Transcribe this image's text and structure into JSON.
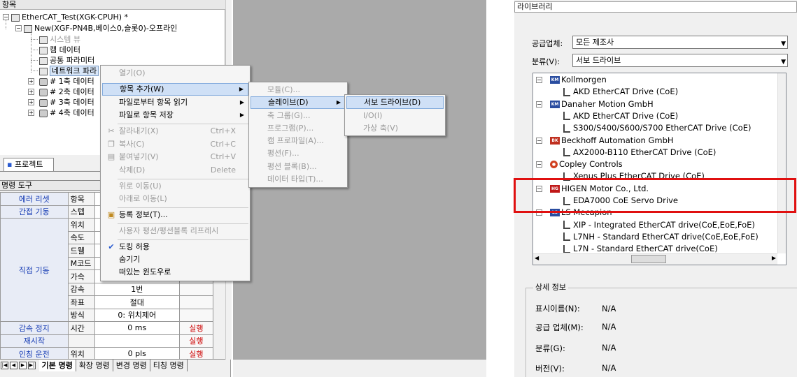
{
  "project_tree": {
    "header": "항목",
    "root": "EtherCAT_Test(XGK-CPUH) *",
    "module": "New(XGF-PN4B,베이스0,슬롯0)-오프라인",
    "items": [
      "시스템 뷰",
      "캠 데이터",
      "공통 파라미터",
      "네트워크 파라"
    ],
    "axes": [
      "# 1축 데이터",
      "# 2축 데이터",
      "# 3축 데이터",
      "# 4축 데이터"
    ],
    "project_tab": "프로젝트"
  },
  "command_tool": {
    "header": "명령 도구",
    "rows": [
      {
        "group": "에러 리셋",
        "label": "항목",
        "value": "",
        "run": ""
      },
      {
        "group": "간접 기동",
        "label": "스텝",
        "value": "",
        "run": ""
      },
      {
        "group": "",
        "label": "위치",
        "value": "",
        "run": ""
      },
      {
        "group": "",
        "label": "속도",
        "value": "",
        "run": ""
      },
      {
        "group": "",
        "label": "드웰",
        "value": "",
        "run": ""
      },
      {
        "group": "",
        "label": "M코드",
        "value": "",
        "run": ""
      },
      {
        "group": "직접 기동",
        "label": "가속",
        "value": "",
        "run": ""
      },
      {
        "group": "",
        "label": "감속",
        "value": "1번",
        "run": ""
      },
      {
        "group": "",
        "label": "좌표",
        "value": "절대",
        "run": ""
      },
      {
        "group": "",
        "label": "방식",
        "value": "0: 위치제어",
        "run": ""
      },
      {
        "group": "감속 정지",
        "label": "시간",
        "value": "0 ms",
        "run": "실행"
      },
      {
        "group": "재시작",
        "label": "",
        "value": "",
        "run": "실행"
      },
      {
        "group": "인칭 운전",
        "label": "위치",
        "value": "0 pls",
        "run": "실행"
      }
    ],
    "bottom_tabs": [
      "기본 명령",
      "확장 명령",
      "변경 명령",
      "티칭 명령"
    ]
  },
  "context_menu": {
    "items": [
      {
        "label": "열기(O)",
        "shortcut": "",
        "disabled": true
      },
      {
        "label": "항목 추가(W)",
        "shortcut": "",
        "disabled": false,
        "submenu": true
      },
      {
        "label": "파일로부터 항목 읽기",
        "shortcut": "",
        "disabled": false,
        "submenu": true
      },
      {
        "label": "파일로 항목 저장",
        "shortcut": "",
        "disabled": false,
        "submenu": true
      },
      {
        "label": "잘라내기(X)",
        "shortcut": "Ctrl+X",
        "disabled": true
      },
      {
        "label": "복사(C)",
        "shortcut": "Ctrl+C",
        "disabled": true
      },
      {
        "label": "붙여넣기(V)",
        "shortcut": "Ctrl+V",
        "disabled": true
      },
      {
        "label": "삭제(D)",
        "shortcut": "Delete",
        "disabled": true
      },
      {
        "label": "위로 이동(U)",
        "shortcut": "",
        "disabled": true
      },
      {
        "label": "아래로 이동(L)",
        "shortcut": "",
        "disabled": true
      },
      {
        "label": "등록 정보(T)...",
        "shortcut": "",
        "disabled": false
      },
      {
        "label": "사용자 평션/평션블록 리프레시",
        "shortcut": "",
        "disabled": true
      },
      {
        "label": "도킹 허용",
        "shortcut": "",
        "disabled": false
      },
      {
        "label": "숨기기",
        "shortcut": "",
        "disabled": false
      },
      {
        "label": "떠있는 윈도우로",
        "shortcut": "",
        "disabled": false
      }
    ],
    "submenu1": [
      "모듈(C)...",
      "슬레이브(D)",
      "축 그룹(G)...",
      "프로그램(P)...",
      "캠 프로파일(A)...",
      "평션(F)...",
      "평션 블록(B)...",
      "데이터 타입(T)..."
    ],
    "submenu2": [
      "서보 드라이브(D)",
      "I/O(I)",
      "가상 축(V)"
    ]
  },
  "library": {
    "header": "라이브러리",
    "vendor_label": "공급업체:",
    "vendor_value": "모든 제조사",
    "category_label": "분류(V):",
    "category_value": "서보 드라이브",
    "tree": [
      {
        "company": "Kollmorgen",
        "drives": [
          "AKD EtherCAT Drive (CoE)"
        ]
      },
      {
        "company": "Danaher Motion GmbH",
        "drives": [
          "AKD EtherCAT Drive (CoE)",
          "S300/S400/S600/S700 EtherCAT Drive (CoE)"
        ]
      },
      {
        "company": "Beckhoff Automation GmbH",
        "drives": [
          "AX2000-B110 EtherCAT Drive (CoE)"
        ]
      },
      {
        "company": "Copley Controls",
        "drives": [
          "Xenus Plus EtherCAT Drive (CoE)"
        ]
      },
      {
        "company": "HIGEN Motor Co., Ltd.",
        "drives": [
          "EDA7000 CoE Servo Drive"
        ]
      },
      {
        "company": "LS Mecapion",
        "drives": [
          "XIP - Integrated EtherCAT drive(CoE,EoE,FoE)",
          "L7NH - Standard EtherCAT drive(CoE,EoE,FoE)",
          "L7N - Standard EtherCAT drive(CoE)"
        ]
      }
    ],
    "details_title": "상세 정보",
    "details": [
      {
        "label": "표시이름(N):",
        "value": "N/A"
      },
      {
        "label": "공급 업체(M):",
        "value": "N/A"
      },
      {
        "label": "분류(G):",
        "value": "N/A"
      },
      {
        "label": "버전(V):",
        "value": "N/A"
      }
    ]
  },
  "colors": {
    "highlight_box": "#e01010",
    "menu_highlight": "#cfe0f6",
    "link_blue": "#1a3fb5",
    "run_red": "#cc0000"
  }
}
